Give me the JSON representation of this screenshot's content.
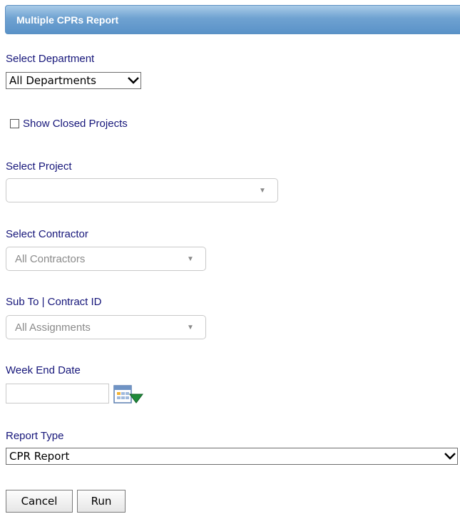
{
  "header": {
    "title": "Multiple CPRs Report"
  },
  "department": {
    "label": "Select Department",
    "selected": "All Departments"
  },
  "show_closed": {
    "label": "Show Closed Projects",
    "checked": false
  },
  "project": {
    "label": "Select Project",
    "selected": ""
  },
  "contractor": {
    "label": "Select Contractor",
    "selected": "All Contractors"
  },
  "sub_to": {
    "label": "Sub To | Contract ID",
    "selected": "All Assignments"
  },
  "week_end": {
    "label": "Week End Date",
    "value": ""
  },
  "report_type": {
    "label": "Report Type",
    "selected": "CPR Report"
  },
  "actions": {
    "cancel_label": "Cancel",
    "run_label": "Run"
  },
  "icons": {
    "calendar": "calendar-icon",
    "dropdown": "chevron-down-icon",
    "combo_arrow": "caret-down-icon"
  },
  "colors": {
    "header_gradient_top": "#a9cbe8",
    "header_gradient_bottom": "#5a92c8",
    "label_text": "#16167a",
    "placeholder_text": "#8a8a8a"
  }
}
